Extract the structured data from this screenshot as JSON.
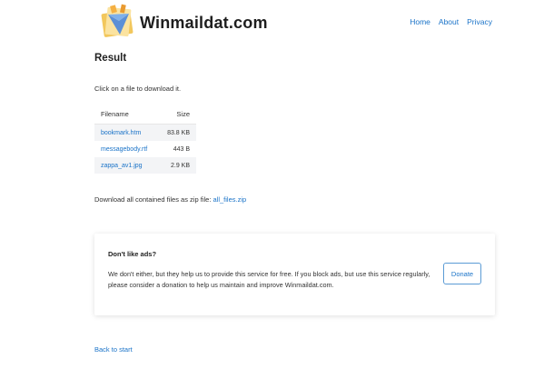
{
  "header": {
    "brand": "Winmaildat.com",
    "nav": [
      "Home",
      "About",
      "Privacy"
    ]
  },
  "main": {
    "heading": "Result",
    "instruction": "Click on a file to download it.",
    "table": {
      "columns": [
        "Filename",
        "Size"
      ],
      "rows": [
        {
          "name": "bookmark.htm",
          "size": "83.8 KB"
        },
        {
          "name": "messagebody.rtf",
          "size": "443 B"
        },
        {
          "name": "zappa_av1.jpg",
          "size": "2.9 KB"
        }
      ]
    },
    "zip": {
      "text": "Download all contained files as zip file:",
      "link": "all_files.zip"
    }
  },
  "ad": {
    "title": "Don't like ads?",
    "text": "We don't either, but they help us to provide this service for free. If you block ads, but use this service regularly, please consider a donation to help us maintain and improve Winmaildat.com.",
    "button": "Donate"
  },
  "footer": {
    "back": "Back to start"
  },
  "colors": {
    "link": "#1a73c8",
    "logo_envelope": "#5b8fd6",
    "logo_paper": "#f2c75c"
  }
}
